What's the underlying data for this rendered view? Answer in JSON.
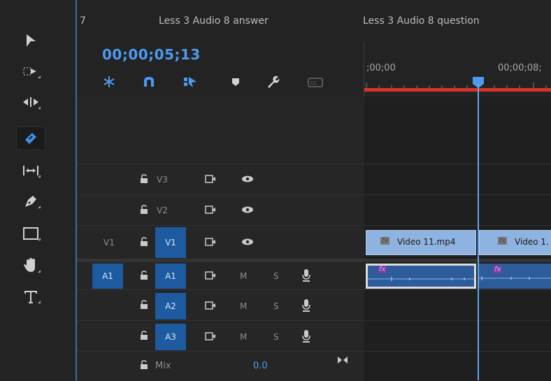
{
  "tools": [
    {
      "name": "selection-tool",
      "icon": "arrow-icon",
      "selected": false
    },
    {
      "name": "track-select-tool",
      "icon": "track-select-icon",
      "selected": false
    },
    {
      "name": "ripple-edit-tool",
      "icon": "ripple-edit-icon",
      "selected": false
    },
    {
      "name": "razor-tool",
      "icon": "razor-icon",
      "selected": true
    },
    {
      "name": "slip-tool",
      "icon": "slip-icon",
      "selected": false
    },
    {
      "name": "pen-tool",
      "icon": "pen-icon",
      "selected": false
    },
    {
      "name": "rectangle-tool",
      "icon": "rectangle-icon",
      "selected": false
    },
    {
      "name": "hand-tool",
      "icon": "hand-icon",
      "selected": false
    },
    {
      "name": "type-tool",
      "icon": "type-icon",
      "selected": false
    }
  ],
  "header": {
    "tab_fragment": "7",
    "tab_answer": "Less 3 Audio 8 answer",
    "tab_question": "Less 3 Audio 8 question",
    "timecode": "00;00;05;13",
    "ruler_start": ";00;00",
    "ruler_mark": "00;00;08;"
  },
  "tracks": {
    "v3": {
      "label": "V3"
    },
    "v2": {
      "label": "V2"
    },
    "v1": {
      "source": "V1",
      "label": "V1"
    },
    "a1": {
      "source": "A1",
      "label": "A1",
      "mute": "M",
      "solo": "S"
    },
    "a2": {
      "label": "A2",
      "mute": "M",
      "solo": "S"
    },
    "a3": {
      "label": "A3",
      "mute": "M",
      "solo": "S"
    },
    "mix": {
      "label": "Mix",
      "value": "0.0"
    }
  },
  "clips": {
    "video1": {
      "name": "Video 11.mp4",
      "fx": "fx"
    },
    "video2": {
      "name": "Video 1.",
      "fx": "fx"
    },
    "audio_fx": "fx"
  },
  "colors": {
    "accent": "#4d9bf0",
    "track_target": "#1e5aa0",
    "playhead_bar": "#d8332a",
    "video_clip": "#8fb3e0",
    "audio_clip": "#2c5c99"
  }
}
